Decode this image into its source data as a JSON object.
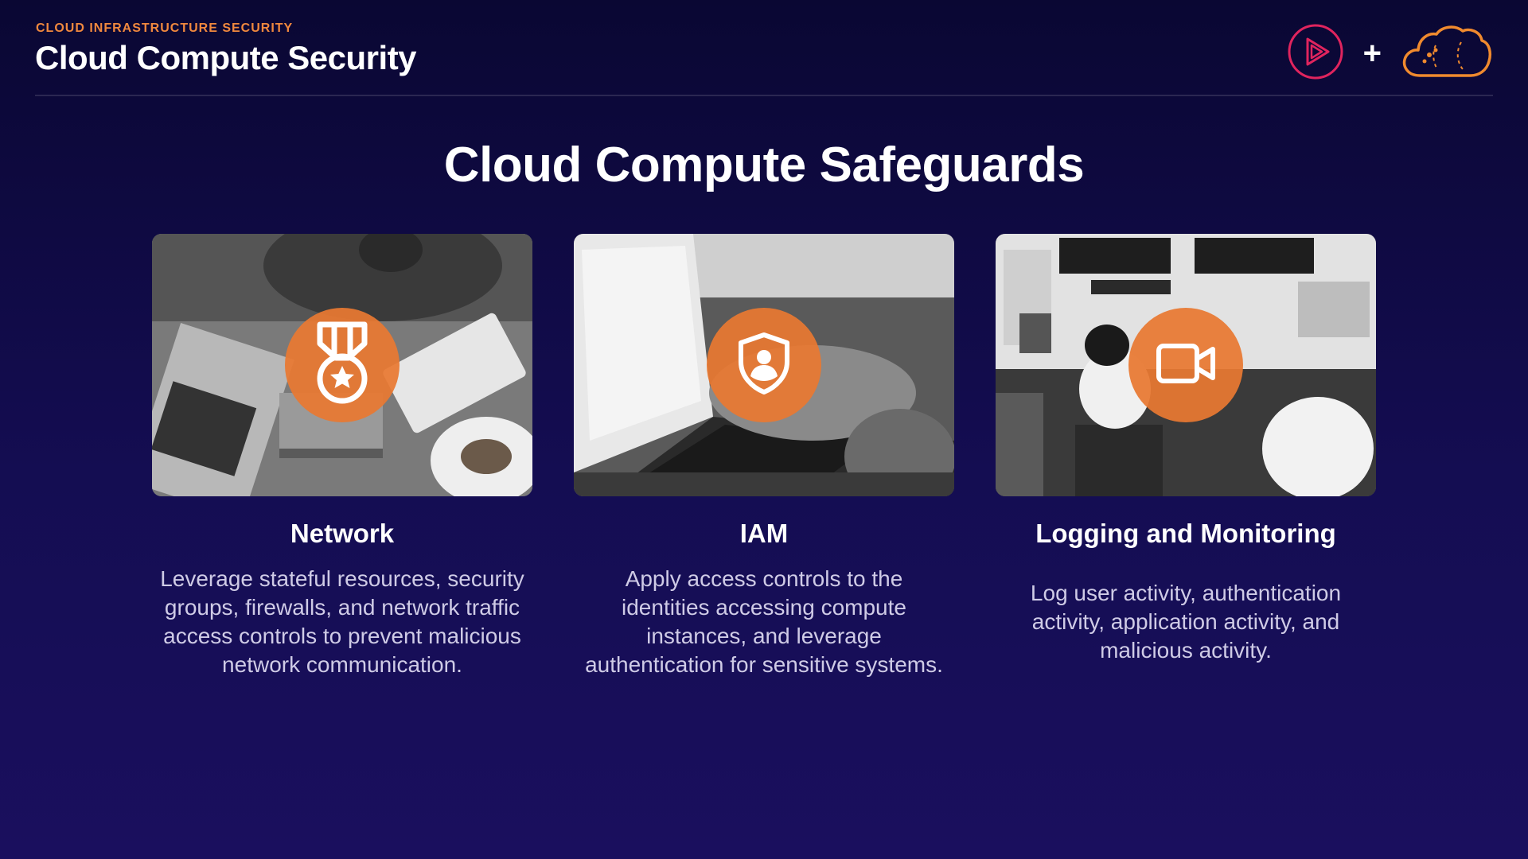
{
  "header": {
    "eyebrow": "CLOUD INFRASTRUCTURE SECURITY",
    "title": "Cloud Compute Security",
    "plus": "+"
  },
  "main": {
    "title": "Cloud Compute Safeguards"
  },
  "cards": [
    {
      "title": "Network",
      "icon": "medal-icon",
      "description": "Leverage stateful resources, security groups, firewalls, and network traffic access controls to prevent malicious network communication."
    },
    {
      "title": "IAM",
      "icon": "shield-user-icon",
      "description": "Apply access controls to the identities accessing compute instances, and leverage authentication for sensitive systems."
    },
    {
      "title": "Logging and Monitoring",
      "icon": "video-camera-icon",
      "description": "Log user activity, authentication activity, application activity, and malicious activity."
    }
  ],
  "colors": {
    "accent": "#f0883e",
    "badge": "#e87832",
    "background": "#140d52",
    "text_muted": "#cfcbe6"
  }
}
